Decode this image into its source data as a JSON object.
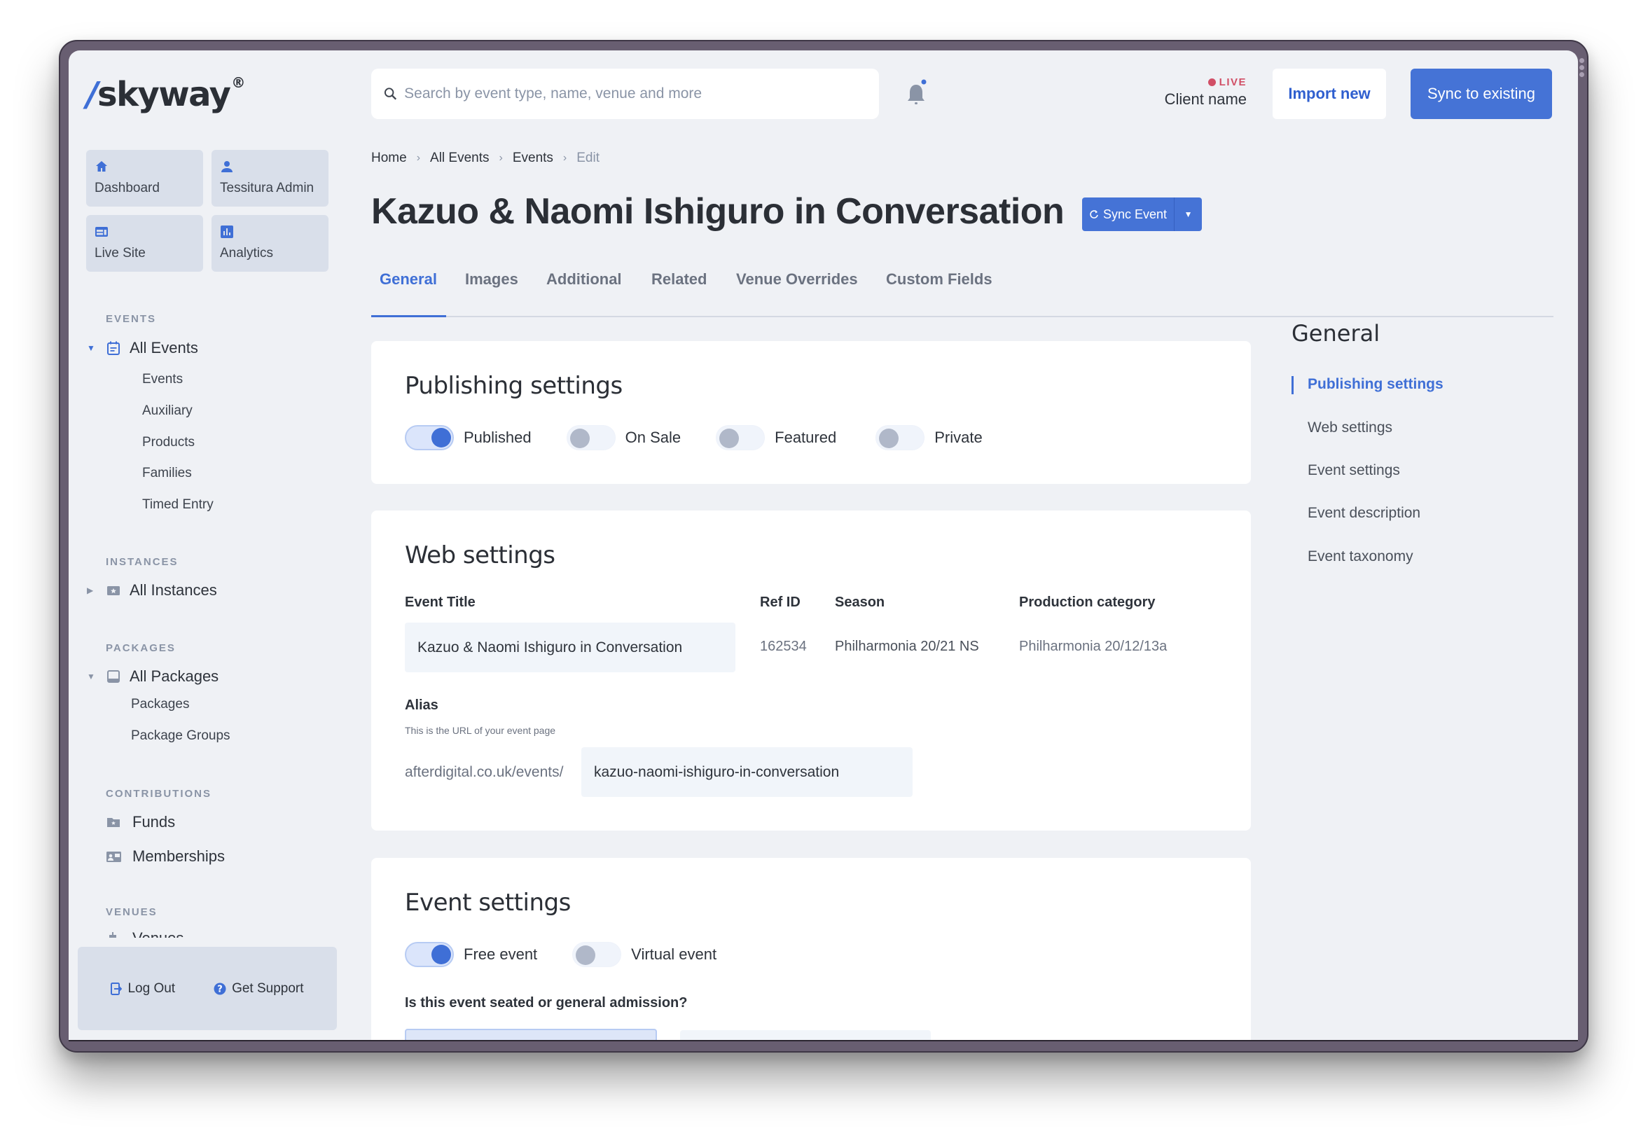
{
  "app": {
    "logo_text": "skyway",
    "logo_slash": "/",
    "logo_mark": "®"
  },
  "colors": {
    "accent": "#4573d6",
    "live": "#d14f66",
    "background": "#eff1f5",
    "frame": "#685e71"
  },
  "header": {
    "search_placeholder": "Search by event type, name, venue and more",
    "search_value": "",
    "notification_icon": "bell-icon",
    "live_label": "LIVE",
    "client_name": "Client name",
    "import_label": "Import new",
    "sync_label": "Sync to existing"
  },
  "sidebar": {
    "quick_links": [
      {
        "label": "Dashboard",
        "icon": "home-icon"
      },
      {
        "label": "Tessitura Admin",
        "icon": "user-icon"
      },
      {
        "label": "Live Site",
        "icon": "browser-icon"
      },
      {
        "label": "Analytics",
        "icon": "bar-chart-icon"
      }
    ],
    "sections": {
      "events": {
        "title": "EVENTS",
        "top": "All Events",
        "expanded": true,
        "items": [
          "Events",
          "Auxiliary",
          "Products",
          "Families",
          "Timed Entry"
        ]
      },
      "instances": {
        "title": "INSTANCES",
        "top": "All Instances",
        "expanded": false
      },
      "packages": {
        "title": "PACKAGES",
        "top": "All Packages",
        "expanded": true,
        "items": [
          "Packages",
          "Package Groups"
        ]
      },
      "contributions": {
        "title": "CONTRIBUTIONS",
        "items": [
          "Funds",
          "Memberships"
        ]
      },
      "venues": {
        "title": "VENUES",
        "items": [
          "Venues"
        ]
      }
    },
    "footer": {
      "logout_label": "Log Out",
      "support_label": "Get Support"
    }
  },
  "breadcrumb": [
    "Home",
    "All Events",
    "Events",
    "Edit"
  ],
  "page": {
    "title": "Kazuo & Naomi Ishiguro in Conversation",
    "sync_event_label": "Sync Event"
  },
  "tabs": [
    {
      "label": "General",
      "active": true
    },
    {
      "label": "Images",
      "active": false
    },
    {
      "label": "Additional",
      "active": false
    },
    {
      "label": "Related",
      "active": false
    },
    {
      "label": "Venue Overrides",
      "active": false
    },
    {
      "label": "Custom Fields",
      "active": false
    }
  ],
  "publishing": {
    "title": "Publishing settings",
    "toggles": [
      {
        "label": "Published",
        "on": true
      },
      {
        "label": "On Sale",
        "on": false
      },
      {
        "label": "Featured",
        "on": false
      },
      {
        "label": "Private",
        "on": false
      }
    ]
  },
  "web": {
    "title": "Web settings",
    "event_title_label": "Event Title",
    "event_title_value": "Kazuo & Naomi Ishiguro in Conversation",
    "ref_id_label": "Ref ID",
    "ref_id_value": "162534",
    "season_label": "Season",
    "season_value": "Philharmonia 20/21 NS",
    "production_label": "Production category",
    "production_value": "Philharmonia 20/12/13a",
    "alias_label": "Alias",
    "alias_hint": "This is the URL of your event page",
    "alias_prefix": "afterdigital.co.uk/events/",
    "alias_value": "kazuo-naomi-ishiguro-in-conversation"
  },
  "event_settings": {
    "title": "Event settings",
    "toggles": [
      {
        "label": "Free event",
        "on": true
      },
      {
        "label": "Virtual event",
        "on": false
      }
    ],
    "question": "Is this event seated or general admission?"
  },
  "toc": {
    "title": "General",
    "items": [
      {
        "label": "Publishing settings",
        "active": true
      },
      {
        "label": "Web settings",
        "active": false
      },
      {
        "label": "Event settings",
        "active": false
      },
      {
        "label": "Event description",
        "active": false
      },
      {
        "label": "Event taxonomy",
        "active": false
      }
    ]
  }
}
